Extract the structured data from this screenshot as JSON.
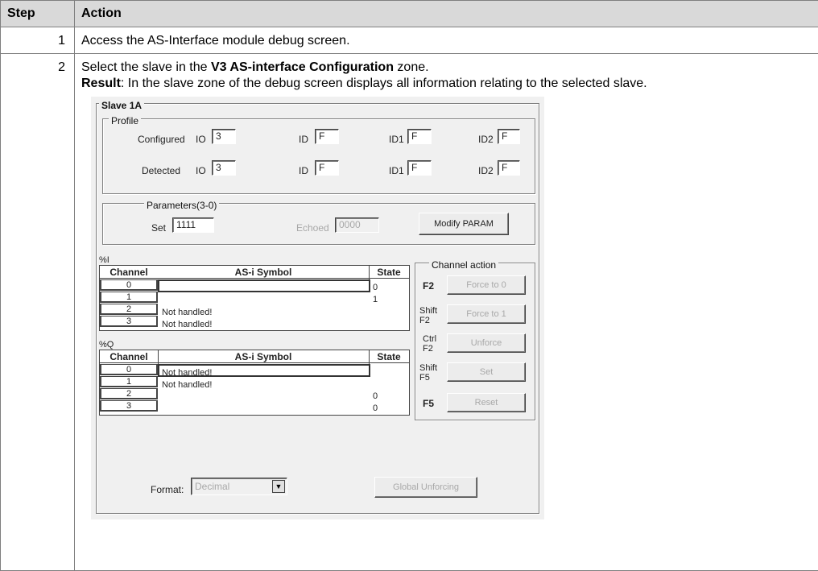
{
  "table": {
    "headers": {
      "step": "Step",
      "action": "Action"
    },
    "row1": {
      "step": "1",
      "action": "Access the AS-Interface module debug screen."
    },
    "row2": {
      "step": "2",
      "line1_pre": "Select the slave in the ",
      "line1_bold": "V3 AS-interface Configuration",
      "line1_post": " zone.",
      "line2_bold": "Result",
      "line2_post": ": In the slave zone of the debug screen displays all information relating to the selected slave."
    }
  },
  "panel": {
    "title": "Slave 1A",
    "profile": {
      "title": "Profile",
      "configured_label": "Configured",
      "detected_label": "Detected",
      "io_label": "IO",
      "id_label": "ID",
      "id1_label": "ID1",
      "id2_label": "ID2",
      "configured": {
        "io": "3",
        "id": "F",
        "id1": "F",
        "id2": "F"
      },
      "detected": {
        "io": "3",
        "id": "F",
        "id1": "F",
        "id2": "F"
      }
    },
    "parameters": {
      "title": "Parameters(3-0)",
      "set_label": "Set",
      "set_value": "1111",
      "echoed_label": "Echoed",
      "echoed_value": "0000",
      "modify_button": "Modify PARAM"
    },
    "inputs": {
      "title": "%I",
      "col_channel": "Channel",
      "col_symbol": "AS-i Symbol",
      "col_state": "State",
      "rows": [
        {
          "channel": "0",
          "symbol": "",
          "state": "0"
        },
        {
          "channel": "1",
          "symbol": "",
          "state": "1"
        },
        {
          "channel": "2",
          "symbol": "Not handled!",
          "state": ""
        },
        {
          "channel": "3",
          "symbol": "Not handled!",
          "state": ""
        }
      ]
    },
    "outputs": {
      "title": "%Q",
      "col_channel": "Channel",
      "col_symbol": "AS-i Symbol",
      "col_state": "State",
      "rows": [
        {
          "channel": "0",
          "symbol": "Not handled!",
          "state": ""
        },
        {
          "channel": "1",
          "symbol": "Not handled!",
          "state": ""
        },
        {
          "channel": "2",
          "symbol": "",
          "state": "0"
        },
        {
          "channel": "3",
          "symbol": "",
          "state": "0"
        }
      ]
    },
    "channel_action": {
      "title": "Channel action",
      "force0_key": "F2",
      "force0_label": "Force to 0",
      "force1_key_1": "Shift",
      "force1_key_2": "F2",
      "force1_label": "Force to 1",
      "unforce_key_1": "Ctrl",
      "unforce_key_2": "F2",
      "unforce_label": "Unforce",
      "set_key_1": "Shift",
      "set_key_2": "F5",
      "set_label": "Set",
      "reset_key": "F5",
      "reset_label": "Reset"
    },
    "format_label": "Format:",
    "format_value": "Decimal",
    "global_unforcing": "Global Unforcing"
  }
}
